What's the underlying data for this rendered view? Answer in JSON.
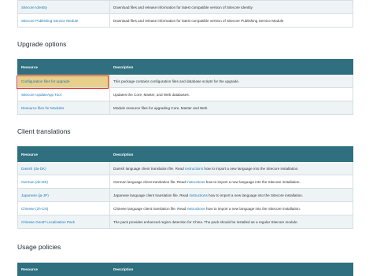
{
  "top_table": {
    "rows": [
      {
        "resource": "Sitecore Identity",
        "description": "Download files and release information for latest compatible version of Sitecore Identity"
      },
      {
        "resource": "Sitecore Publishing Service Module",
        "description": "Download files and release information for latest compatible version of Sitecore Publishing Service Module"
      }
    ]
  },
  "upgrade": {
    "heading": "Upgrade options",
    "col_resource": "Resource",
    "col_description": "Description",
    "rows": [
      {
        "resource": "Configuration files for upgrade",
        "description": "This package contains configuration files and database scripts for the upgrade."
      },
      {
        "resource": "Sitecore UpdateApp Tool",
        "description": "Updates the Core, Master, and Web databases."
      },
      {
        "resource": "Resource files for Modules",
        "description": "Module resource files for upgrading Core, Master and Web"
      }
    ]
  },
  "translations": {
    "heading": "Client translations",
    "col_resource": "Resource",
    "col_description": "Description",
    "link_word": "instructions",
    "rows": [
      {
        "resource": "Danish (da-DK)",
        "desc_pre": "Danish language client translation file. Read ",
        "desc_post": " how to import a new language into the Sitecore installation."
      },
      {
        "resource": "German (de-DE)",
        "desc_pre": "German language client translation file. Read ",
        "desc_post": " how to import a new language into the Sitecore installation."
      },
      {
        "resource": "Japanese (ja-JP)",
        "desc_pre": "Japanese language client translation file. Read ",
        "desc_post": " how to import a new language into the Sitecore installation."
      },
      {
        "resource": "Chinese (zh-CN)",
        "desc_pre": "Chinese language client translation file. Read ",
        "desc_post": " how to import a new language into the Sitecore installation."
      },
      {
        "resource": "Chinese GeoIP Localization Pack",
        "desc_pre": "The pack provides enhanced region detection for China. The pack should be installed as a regular Sitecore module.",
        "desc_post": ""
      }
    ]
  },
  "usage": {
    "heading": "Usage policies",
    "col_resource": "Resource",
    "col_description": "Description"
  },
  "colors": {
    "header_bg": "#2f6f7f",
    "link": "#1b78b8",
    "highlight_fill": "#e8cf8a",
    "highlight_border": "#e53b3b"
  }
}
